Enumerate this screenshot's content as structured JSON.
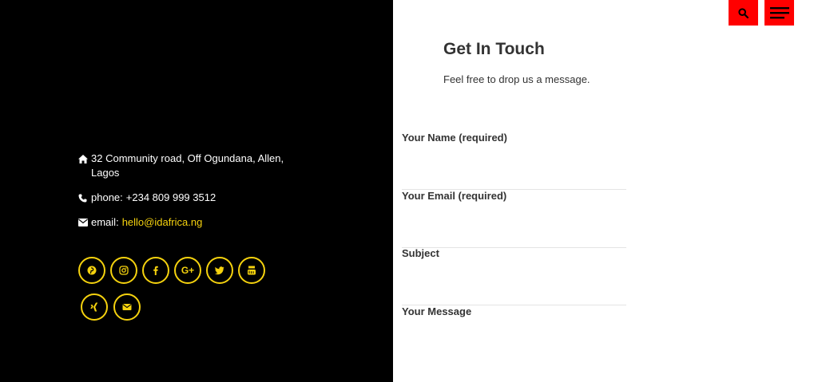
{
  "contact": {
    "address": "32 Community road, Off Ogundana, Allen, Lagos",
    "phone_label": "phone:",
    "phone": "+234 809 999 3512",
    "email_label": "email:",
    "email": "hello@idafrica.ng"
  },
  "social": {
    "google_plus_text": "G+"
  },
  "form": {
    "title": "Get In Touch",
    "subtitle": "Feel free to drop us a message.",
    "name_label": "Your Name (required)",
    "email_label": "Your Email (required)",
    "subject_label": "Subject",
    "message_label": "Your Message"
  },
  "colors": {
    "accent": "#f5d20e",
    "top_button": "#ff0000",
    "left_bg": "#000000"
  },
  "icons": {
    "address": "home-icon",
    "phone": "phone-icon",
    "email": "envelope-icon",
    "social": [
      "pinterest-icon",
      "instagram-icon",
      "facebook-icon",
      "google-plus-icon",
      "twitter-icon",
      "youtube-icon",
      "xing-icon",
      "envelope-icon"
    ],
    "header": [
      "search-icon",
      "menu-icon"
    ]
  }
}
